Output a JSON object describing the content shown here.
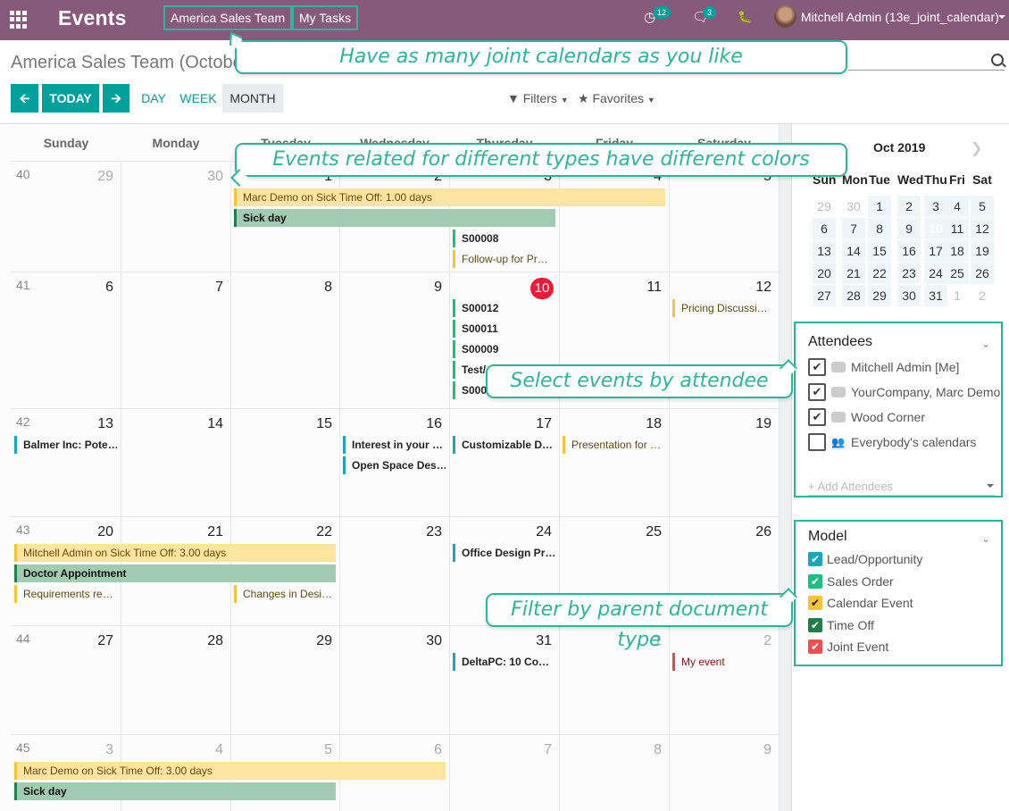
{
  "topbar": {
    "app_title": "Events",
    "menu": [
      "America Sales Team",
      "My Tasks"
    ],
    "activity_count": "12",
    "messages_count": "3",
    "user": "Mitchell Admin (13e_joint_calendar)"
  },
  "control_panel": {
    "breadcrumb": "America Sales Team (October",
    "today_label": "TODAY",
    "views": [
      "DAY",
      "WEEK",
      "MONTH"
    ],
    "active_view": "MONTH",
    "filters_label": "Filters",
    "favorites_label": "Favorites"
  },
  "calendar": {
    "day_headers": [
      "Sunday",
      "Monday",
      "Tuesday",
      "Wednesday",
      "Thursday",
      "Friday",
      "Saturday"
    ],
    "weeks": [
      {
        "num": "40",
        "days": [
          "29",
          "30",
          "1",
          "2",
          "3",
          "4",
          "5"
        ],
        "other": [
          true,
          true,
          false,
          false,
          false,
          false,
          false
        ]
      },
      {
        "num": "41",
        "days": [
          "6",
          "7",
          "8",
          "9",
          "10",
          "11",
          "12"
        ],
        "other": [
          false,
          false,
          false,
          false,
          false,
          false,
          false
        ]
      },
      {
        "num": "42",
        "days": [
          "13",
          "14",
          "15",
          "16",
          "17",
          "18",
          "19"
        ],
        "other": [
          false,
          false,
          false,
          false,
          false,
          false,
          false
        ]
      },
      {
        "num": "43",
        "days": [
          "20",
          "21",
          "22",
          "23",
          "24",
          "25",
          "26"
        ],
        "other": [
          false,
          false,
          false,
          false,
          false,
          false,
          false
        ]
      },
      {
        "num": "44",
        "days": [
          "27",
          "28",
          "29",
          "30",
          "31",
          "1",
          "2"
        ],
        "other": [
          false,
          false,
          false,
          false,
          false,
          true,
          true
        ]
      },
      {
        "num": "45",
        "days": [
          "3",
          "4",
          "5",
          "6",
          "7",
          "8",
          "9"
        ],
        "other": [
          true,
          true,
          true,
          true,
          true,
          true,
          true
        ]
      }
    ],
    "today": "10",
    "events": [
      {
        "week": 0,
        "start": 2,
        "span": 4,
        "slot": 0,
        "type": "timeoff",
        "title": "Marc Demo on Sick Time Off: 1.00 days"
      },
      {
        "week": 0,
        "start": 2,
        "span": 3,
        "slot": 1,
        "type": "sick",
        "title": "Sick day"
      },
      {
        "week": 0,
        "start": 4,
        "span": 1,
        "slot": 2,
        "type": "sale",
        "title": "S00008"
      },
      {
        "week": 0,
        "start": 4,
        "span": 1,
        "slot": 3,
        "type": "cal",
        "title": "Follow-up for Pr…"
      },
      {
        "week": 1,
        "start": 4,
        "span": 1,
        "slot": 0,
        "type": "sale",
        "title": "S00012"
      },
      {
        "week": 1,
        "start": 4,
        "span": 1,
        "slot": 1,
        "type": "sale",
        "title": "S00011"
      },
      {
        "week": 1,
        "start": 4,
        "span": 1,
        "slot": 2,
        "type": "sale",
        "title": "S00009"
      },
      {
        "week": 1,
        "start": 4,
        "span": 1,
        "slot": 3,
        "type": "sale",
        "title": "Test/…"
      },
      {
        "week": 1,
        "start": 4,
        "span": 1,
        "slot": 4,
        "type": "sale",
        "title": "S0000…"
      },
      {
        "week": 1,
        "start": 6,
        "span": 1,
        "slot": 0,
        "type": "cal",
        "title": "Pricing Discussi…"
      },
      {
        "week": 2,
        "start": 0,
        "span": 1,
        "slot": 0,
        "type": "lead",
        "title": "Balmer Inc: Pote…"
      },
      {
        "week": 2,
        "start": 3,
        "span": 1,
        "slot": 0,
        "type": "lead",
        "title": "Interest in your …"
      },
      {
        "week": 2,
        "start": 3,
        "span": 1,
        "slot": 1,
        "type": "lead",
        "title": "Open Space Des…"
      },
      {
        "week": 2,
        "start": 4,
        "span": 1,
        "slot": 0,
        "type": "lead",
        "title": "Customizable D…"
      },
      {
        "week": 2,
        "start": 5,
        "span": 1,
        "slot": 0,
        "type": "cal",
        "title": "Presentation for …"
      },
      {
        "week": 3,
        "start": 0,
        "span": 3,
        "slot": 0,
        "type": "timeoff",
        "title": "Mitchell Admin on Sick Time Off: 3.00 days"
      },
      {
        "week": 3,
        "start": 0,
        "span": 3,
        "slot": 1,
        "type": "sick",
        "title": "Doctor Appointment"
      },
      {
        "week": 3,
        "start": 0,
        "span": 1,
        "slot": 2,
        "type": "cal",
        "title": "Requirements re…"
      },
      {
        "week": 3,
        "start": 2,
        "span": 1,
        "slot": 2,
        "type": "cal",
        "title": "Changes in Desi…"
      },
      {
        "week": 3,
        "start": 4,
        "span": 1,
        "slot": 0,
        "type": "lead",
        "title": "Office Design Pr…"
      },
      {
        "week": 4,
        "start": 4,
        "span": 1,
        "slot": 0,
        "type": "lead",
        "title": "DeltaPC: 10 Co…"
      },
      {
        "week": 4,
        "start": 6,
        "span": 1,
        "slot": 0,
        "type": "joint",
        "title": "My event"
      },
      {
        "week": 5,
        "start": 0,
        "span": 4,
        "slot": 0,
        "type": "timeoff",
        "title": "Marc Demo on Sick Time Off: 3.00 days"
      },
      {
        "week": 5,
        "start": 0,
        "span": 3,
        "slot": 1,
        "type": "sick",
        "title": "Sick day"
      }
    ]
  },
  "mini_calendar": {
    "title": "Oct 2019",
    "dow": [
      "Sun",
      "Mon",
      "Tue",
      "Wed",
      "Thu",
      "Fri",
      "Sat"
    ],
    "rows": [
      [
        "29",
        "30",
        "1",
        "2",
        "3",
        "4",
        "5"
      ],
      [
        "6",
        "7",
        "8",
        "9",
        "10",
        "11",
        "12"
      ],
      [
        "13",
        "14",
        "15",
        "16",
        "17",
        "18",
        "19"
      ],
      [
        "20",
        "21",
        "22",
        "23",
        "24",
        "25",
        "26"
      ],
      [
        "27",
        "28",
        "29",
        "30",
        "31",
        "1",
        "2"
      ]
    ],
    "today": "10"
  },
  "attendees": {
    "title": "Attendees",
    "items": [
      {
        "label": "Mitchell Admin [Me]",
        "checked": true,
        "icon": "camera-plus-icon"
      },
      {
        "label": "YourCompany, Marc Demo",
        "checked": true,
        "icon": "camera-plus-icon"
      },
      {
        "label": "Wood Corner",
        "checked": true,
        "icon": "camera-plus-icon"
      },
      {
        "label": "Everybody's calendars",
        "checked": false,
        "icon": "users-icon"
      }
    ],
    "add_placeholder": "+ Add Attendees"
  },
  "model_filter": {
    "title": "Model",
    "items": [
      {
        "label": "Lead/Opportunity",
        "color": "#1ba7ba",
        "check_color": "#ffffff"
      },
      {
        "label": "Sales Order",
        "color": "#1dbf7f",
        "check_color": "#ffffff"
      },
      {
        "label": "Calendar Event",
        "color": "#f7c23b",
        "check_color": "#222222"
      },
      {
        "label": "Time Off",
        "color": "#1e7f49",
        "check_color": "#ffffff"
      },
      {
        "label": "Joint Event",
        "color": "#ef4f4f",
        "check_color": "#ffffff"
      }
    ]
  },
  "callouts": [
    "Have as many joint calendars as you like",
    "Events related for different types have different colors",
    "Select events by attendee",
    "Filter by parent document type"
  ]
}
